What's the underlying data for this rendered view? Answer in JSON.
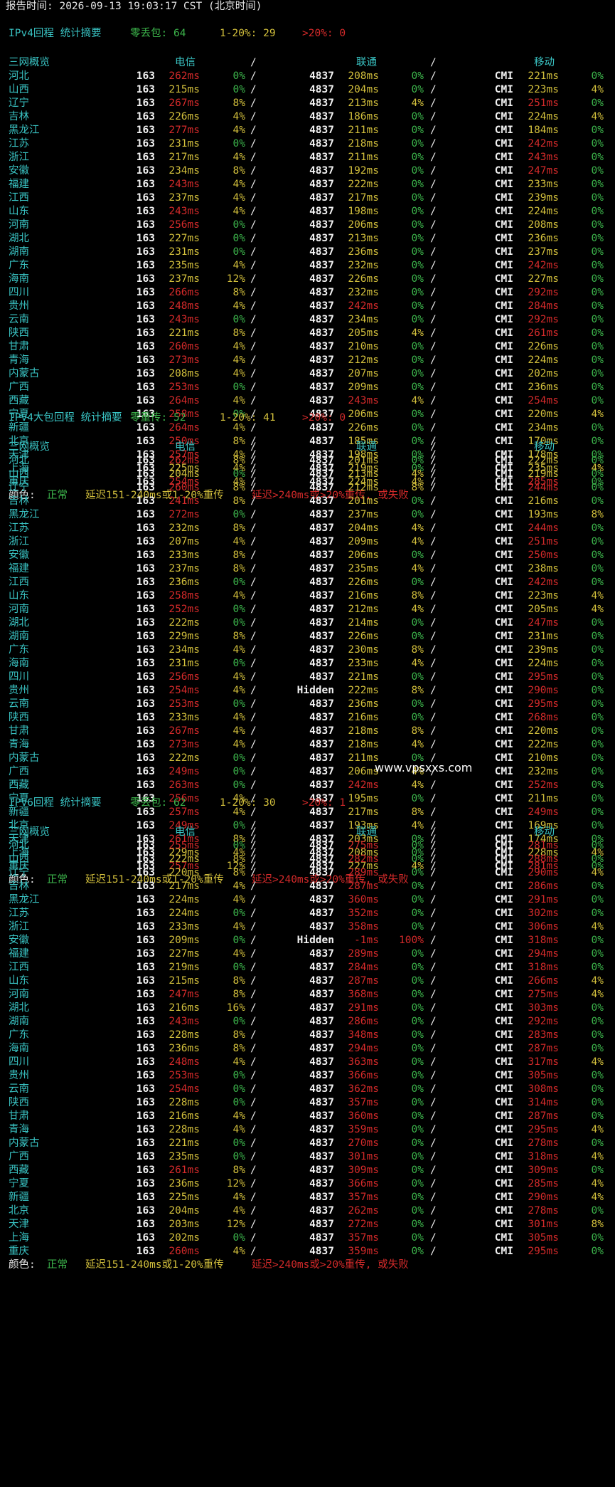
{
  "report_line": "报告时间: 2026-09-13 19:03:17 CST (北京时间)",
  "watermark": "www.vpsxxs.com",
  "column_headers": {
    "overview": "三网概览",
    "telecom": "电信",
    "unicom": "联通",
    "mobile": "移动",
    "sep": "/"
  },
  "legend": {
    "label": "颜色:",
    "normal": "正常",
    "warn": "延迟151-240ms或1-20%重传",
    "bad": "延迟>240ms或>20%重传, 或失败"
  },
  "sections": [
    {
      "title": "IPv4回程 统计摘要",
      "s1_label": "零丢包:",
      "s1_value": "64",
      "s2_label": "1-20%:",
      "s2_value": "29",
      "s3_label": ">20%:",
      "s3_value": "0",
      "rows": [
        [
          "河北",
          "163",
          "262ms",
          "0%",
          "4837",
          "208ms",
          "0%",
          "CMI",
          "221ms",
          "0%"
        ],
        [
          "山西",
          "163",
          "215ms",
          "0%",
          "4837",
          "204ms",
          "0%",
          "CMI",
          "223ms",
          "4%"
        ],
        [
          "辽宁",
          "163",
          "267ms",
          "8%",
          "4837",
          "213ms",
          "4%",
          "CMI",
          "251ms",
          "0%"
        ],
        [
          "吉林",
          "163",
          "226ms",
          "4%",
          "4837",
          "186ms",
          "0%",
          "CMI",
          "224ms",
          "4%"
        ],
        [
          "黑龙江",
          "163",
          "277ms",
          "4%",
          "4837",
          "211ms",
          "0%",
          "CMI",
          "184ms",
          "0%"
        ],
        [
          "江苏",
          "163",
          "231ms",
          "0%",
          "4837",
          "218ms",
          "0%",
          "CMI",
          "242ms",
          "0%"
        ],
        [
          "浙江",
          "163",
          "217ms",
          "4%",
          "4837",
          "211ms",
          "0%",
          "CMI",
          "243ms",
          "0%"
        ],
        [
          "安徽",
          "163",
          "234ms",
          "8%",
          "4837",
          "192ms",
          "0%",
          "CMI",
          "247ms",
          "0%"
        ],
        [
          "福建",
          "163",
          "243ms",
          "4%",
          "4837",
          "222ms",
          "0%",
          "CMI",
          "233ms",
          "0%"
        ],
        [
          "江西",
          "163",
          "237ms",
          "4%",
          "4837",
          "217ms",
          "0%",
          "CMI",
          "239ms",
          "0%"
        ],
        [
          "山东",
          "163",
          "243ms",
          "4%",
          "4837",
          "198ms",
          "0%",
          "CMI",
          "224ms",
          "0%"
        ],
        [
          "河南",
          "163",
          "256ms",
          "0%",
          "4837",
          "206ms",
          "0%",
          "CMI",
          "208ms",
          "0%"
        ],
        [
          "湖北",
          "163",
          "227ms",
          "0%",
          "4837",
          "213ms",
          "0%",
          "CMI",
          "236ms",
          "0%"
        ],
        [
          "湖南",
          "163",
          "231ms",
          "0%",
          "4837",
          "236ms",
          "0%",
          "CMI",
          "237ms",
          "0%"
        ],
        [
          "广东",
          "163",
          "235ms",
          "4%",
          "4837",
          "232ms",
          "0%",
          "CMI",
          "242ms",
          "0%"
        ],
        [
          "海南",
          "163",
          "237ms",
          "12%",
          "4837",
          "226ms",
          "0%",
          "CMI",
          "227ms",
          "0%"
        ],
        [
          "四川",
          "163",
          "266ms",
          "8%",
          "4837",
          "232ms",
          "0%",
          "CMI",
          "292ms",
          "0%"
        ],
        [
          "贵州",
          "163",
          "248ms",
          "4%",
          "4837",
          "242ms",
          "0%",
          "CMI",
          "284ms",
          "0%"
        ],
        [
          "云南",
          "163",
          "243ms",
          "0%",
          "4837",
          "234ms",
          "0%",
          "CMI",
          "292ms",
          "0%"
        ],
        [
          "陕西",
          "163",
          "221ms",
          "8%",
          "4837",
          "205ms",
          "4%",
          "CMI",
          "261ms",
          "0%"
        ],
        [
          "甘肃",
          "163",
          "260ms",
          "4%",
          "4837",
          "210ms",
          "0%",
          "CMI",
          "226ms",
          "0%"
        ],
        [
          "青海",
          "163",
          "273ms",
          "4%",
          "4837",
          "212ms",
          "0%",
          "CMI",
          "224ms",
          "0%"
        ],
        [
          "内蒙古",
          "163",
          "208ms",
          "4%",
          "4837",
          "207ms",
          "0%",
          "CMI",
          "202ms",
          "0%"
        ],
        [
          "广西",
          "163",
          "253ms",
          "0%",
          "4837",
          "209ms",
          "0%",
          "CMI",
          "236ms",
          "0%"
        ],
        [
          "西藏",
          "163",
          "264ms",
          "4%",
          "4837",
          "243ms",
          "4%",
          "CMI",
          "254ms",
          "0%"
        ],
        [
          "宁夏",
          "163",
          "258ms",
          "0%",
          "4837",
          "206ms",
          "0%",
          "CMI",
          "220ms",
          "4%"
        ],
        [
          "新疆",
          "163",
          "264ms",
          "4%",
          "4837",
          "226ms",
          "0%",
          "CMI",
          "234ms",
          "0%"
        ],
        [
          "北京",
          "163",
          "250ms",
          "8%",
          "4837",
          "185ms",
          "0%",
          "CMI",
          "170ms",
          "0%"
        ],
        [
          "天津",
          "163",
          "257ms",
          "4%",
          "4837",
          "198ms",
          "0%",
          "CMI",
          "178ms",
          "0%"
        ],
        [
          "上海",
          "163",
          "225ms",
          "4%",
          "4837",
          "219ms",
          "0%",
          "CMI",
          "235ms",
          "4%"
        ],
        [
          "重庆",
          "163",
          "254ms",
          "4%",
          "4837",
          "224ms",
          "4%",
          "CMI",
          "285ms",
          "0%"
        ]
      ]
    },
    {
      "title": "IPv4大包回程 统计摘要",
      "s1_label": "零重传:",
      "s1_value": "52",
      "s2_label": "1-20%:",
      "s2_value": "41",
      "s3_label": ">20%:",
      "s3_value": "0",
      "rows": [
        [
          "河北",
          "163",
          "262ms",
          "8%",
          "4837",
          "201ms",
          "0%",
          "CMI",
          "222ms",
          "0%"
        ],
        [
          "山西",
          "163",
          "204ms",
          "0%",
          "4837",
          "213ms",
          "4%",
          "CMI",
          "219ms",
          "0%"
        ],
        [
          "辽宁",
          "163",
          "260ms",
          "8%",
          "4837",
          "212ms",
          "8%",
          "CMI",
          "244ms",
          "0%"
        ],
        [
          "吉林",
          "163",
          "241ms",
          "8%",
          "4837",
          "201ms",
          "0%",
          "CMI",
          "216ms",
          "0%"
        ],
        [
          "黑龙江",
          "163",
          "272ms",
          "0%",
          "4837",
          "237ms",
          "0%",
          "CMI",
          "193ms",
          "8%"
        ],
        [
          "江苏",
          "163",
          "232ms",
          "8%",
          "4837",
          "204ms",
          "4%",
          "CMI",
          "244ms",
          "0%"
        ],
        [
          "浙江",
          "163",
          "207ms",
          "4%",
          "4837",
          "209ms",
          "4%",
          "CMI",
          "251ms",
          "0%"
        ],
        [
          "安徽",
          "163",
          "233ms",
          "8%",
          "4837",
          "206ms",
          "0%",
          "CMI",
          "250ms",
          "0%"
        ],
        [
          "福建",
          "163",
          "237ms",
          "8%",
          "4837",
          "235ms",
          "4%",
          "CMI",
          "238ms",
          "0%"
        ],
        [
          "江西",
          "163",
          "236ms",
          "0%",
          "4837",
          "226ms",
          "0%",
          "CMI",
          "242ms",
          "0%"
        ],
        [
          "山东",
          "163",
          "258ms",
          "4%",
          "4837",
          "216ms",
          "8%",
          "CMI",
          "223ms",
          "4%"
        ],
        [
          "河南",
          "163",
          "252ms",
          "0%",
          "4837",
          "212ms",
          "4%",
          "CMI",
          "205ms",
          "4%"
        ],
        [
          "湖北",
          "163",
          "222ms",
          "0%",
          "4837",
          "214ms",
          "0%",
          "CMI",
          "247ms",
          "0%"
        ],
        [
          "湖南",
          "163",
          "229ms",
          "8%",
          "4837",
          "226ms",
          "0%",
          "CMI",
          "231ms",
          "0%"
        ],
        [
          "广东",
          "163",
          "234ms",
          "4%",
          "4837",
          "230ms",
          "8%",
          "CMI",
          "239ms",
          "0%"
        ],
        [
          "海南",
          "163",
          "231ms",
          "0%",
          "4837",
          "233ms",
          "4%",
          "CMI",
          "224ms",
          "0%"
        ],
        [
          "四川",
          "163",
          "256ms",
          "4%",
          "4837",
          "221ms",
          "0%",
          "CMI",
          "295ms",
          "0%"
        ],
        [
          "贵州",
          "163",
          "254ms",
          "4%",
          "Hidden",
          "222ms",
          "8%",
          "CMI",
          "290ms",
          "0%"
        ],
        [
          "云南",
          "163",
          "253ms",
          "0%",
          "4837",
          "236ms",
          "0%",
          "CMI",
          "295ms",
          "0%"
        ],
        [
          "陕西",
          "163",
          "233ms",
          "4%",
          "4837",
          "216ms",
          "0%",
          "CMI",
          "268ms",
          "0%"
        ],
        [
          "甘肃",
          "163",
          "267ms",
          "4%",
          "4837",
          "218ms",
          "8%",
          "CMI",
          "220ms",
          "0%"
        ],
        [
          "青海",
          "163",
          "273ms",
          "4%",
          "4837",
          "218ms",
          "4%",
          "CMI",
          "222ms",
          "0%"
        ],
        [
          "内蒙古",
          "163",
          "222ms",
          "0%",
          "4837",
          "211ms",
          "0%",
          "CMI",
          "210ms",
          "0%"
        ],
        [
          "广西",
          "163",
          "249ms",
          "0%",
          "4837",
          "206ms",
          "4%",
          "CMI",
          "232ms",
          "0%"
        ],
        [
          "西藏",
          "163",
          "263ms",
          "0%",
          "4837",
          "242ms",
          "4%",
          "CMI",
          "252ms",
          "0%"
        ],
        [
          "宁夏",
          "163",
          "256ms",
          "4%",
          "4837",
          "195ms",
          "0%",
          "CMI",
          "211ms",
          "0%"
        ],
        [
          "新疆",
          "163",
          "257ms",
          "4%",
          "4837",
          "217ms",
          "8%",
          "CMI",
          "249ms",
          "0%"
        ],
        [
          "北京",
          "163",
          "249ms",
          "0%",
          "4837",
          "193ms",
          "4%",
          "CMI",
          "169ms",
          "0%"
        ],
        [
          "天津",
          "163",
          "261ms",
          "8%",
          "4837",
          "203ms",
          "0%",
          "CMI",
          "174ms",
          "0%"
        ],
        [
          "上海",
          "163",
          "229ms",
          "4%",
          "4837",
          "208ms",
          "0%",
          "CMI",
          "228ms",
          "4%"
        ],
        [
          "重庆",
          "163",
          "257ms",
          "12%",
          "4837",
          "227ms",
          "4%",
          "CMI",
          "281ms",
          "0%"
        ]
      ]
    },
    {
      "title": "IPv6回程 统计摘要",
      "s1_label": "零丢包:",
      "s1_value": "62",
      "s2_label": "1-20%:",
      "s2_value": "30",
      "s3_label": ">20%:",
      "s3_value": "1",
      "rows": [
        [
          "河北",
          "163",
          "255ms",
          "0%",
          "4837",
          "275ms",
          "0%",
          "CMI",
          "281ms",
          "0%"
        ],
        [
          "山西",
          "163",
          "222ms",
          "8%",
          "4837",
          "282ms",
          "0%",
          "CMI",
          "288ms",
          "0%"
        ],
        [
          "辽宁",
          "163",
          "220ms",
          "8%",
          "4837",
          "289ms",
          "0%",
          "CMI",
          "290ms",
          "4%"
        ],
        [
          "吉林",
          "163",
          "217ms",
          "4%",
          "4837",
          "287ms",
          "0%",
          "CMI",
          "286ms",
          "0%"
        ],
        [
          "黑龙江",
          "163",
          "224ms",
          "4%",
          "4837",
          "360ms",
          "0%",
          "CMI",
          "291ms",
          "0%"
        ],
        [
          "江苏",
          "163",
          "224ms",
          "0%",
          "4837",
          "352ms",
          "0%",
          "CMI",
          "302ms",
          "0%"
        ],
        [
          "浙江",
          "163",
          "233ms",
          "4%",
          "4837",
          "358ms",
          "0%",
          "CMI",
          "306ms",
          "4%"
        ],
        [
          "安徽",
          "163",
          "209ms",
          "0%",
          "Hidden",
          "-1ms",
          "100%",
          "CMI",
          "318ms",
          "0%"
        ],
        [
          "福建",
          "163",
          "227ms",
          "4%",
          "4837",
          "289ms",
          "0%",
          "CMI",
          "294ms",
          "0%"
        ],
        [
          "江西",
          "163",
          "219ms",
          "0%",
          "4837",
          "284ms",
          "0%",
          "CMI",
          "318ms",
          "0%"
        ],
        [
          "山东",
          "163",
          "215ms",
          "8%",
          "4837",
          "287ms",
          "0%",
          "CMI",
          "266ms",
          "4%"
        ],
        [
          "河南",
          "163",
          "247ms",
          "8%",
          "4837",
          "368ms",
          "0%",
          "CMI",
          "275ms",
          "4%"
        ],
        [
          "湖北",
          "163",
          "216ms",
          "16%",
          "4837",
          "291ms",
          "0%",
          "CMI",
          "303ms",
          "0%"
        ],
        [
          "湖南",
          "163",
          "243ms",
          "0%",
          "4837",
          "286ms",
          "0%",
          "CMI",
          "292ms",
          "0%"
        ],
        [
          "广东",
          "163",
          "228ms",
          "8%",
          "4837",
          "348ms",
          "0%",
          "CMI",
          "283ms",
          "0%"
        ],
        [
          "海南",
          "163",
          "236ms",
          "8%",
          "4837",
          "294ms",
          "0%",
          "CMI",
          "287ms",
          "0%"
        ],
        [
          "四川",
          "163",
          "248ms",
          "4%",
          "4837",
          "363ms",
          "0%",
          "CMI",
          "317ms",
          "4%"
        ],
        [
          "贵州",
          "163",
          "253ms",
          "0%",
          "4837",
          "366ms",
          "0%",
          "CMI",
          "305ms",
          "0%"
        ],
        [
          "云南",
          "163",
          "254ms",
          "0%",
          "4837",
          "362ms",
          "0%",
          "CMI",
          "308ms",
          "0%"
        ],
        [
          "陕西",
          "163",
          "228ms",
          "0%",
          "4837",
          "357ms",
          "0%",
          "CMI",
          "314ms",
          "0%"
        ],
        [
          "甘肃",
          "163",
          "216ms",
          "4%",
          "4837",
          "360ms",
          "0%",
          "CMI",
          "287ms",
          "0%"
        ],
        [
          "青海",
          "163",
          "228ms",
          "4%",
          "4837",
          "359ms",
          "0%",
          "CMI",
          "295ms",
          "4%"
        ],
        [
          "内蒙古",
          "163",
          "221ms",
          "0%",
          "4837",
          "270ms",
          "0%",
          "CMI",
          "278ms",
          "0%"
        ],
        [
          "广西",
          "163",
          "235ms",
          "0%",
          "4837",
          "301ms",
          "0%",
          "CMI",
          "318ms",
          "4%"
        ],
        [
          "西藏",
          "163",
          "261ms",
          "8%",
          "4837",
          "309ms",
          "0%",
          "CMI",
          "309ms",
          "0%"
        ],
        [
          "宁夏",
          "163",
          "236ms",
          "12%",
          "4837",
          "366ms",
          "0%",
          "CMI",
          "285ms",
          "4%"
        ],
        [
          "新疆",
          "163",
          "225ms",
          "4%",
          "4837",
          "357ms",
          "0%",
          "CMI",
          "290ms",
          "4%"
        ],
        [
          "北京",
          "163",
          "204ms",
          "4%",
          "4837",
          "262ms",
          "0%",
          "CMI",
          "278ms",
          "0%"
        ],
        [
          "天津",
          "163",
          "203ms",
          "12%",
          "4837",
          "272ms",
          "0%",
          "CMI",
          "301ms",
          "8%"
        ],
        [
          "上海",
          "163",
          "202ms",
          "0%",
          "4837",
          "357ms",
          "0%",
          "CMI",
          "305ms",
          "0%"
        ],
        [
          "重庆",
          "163",
          "260ms",
          "4%",
          "4837",
          "359ms",
          "0%",
          "CMI",
          "295ms",
          "0%"
        ]
      ]
    }
  ]
}
